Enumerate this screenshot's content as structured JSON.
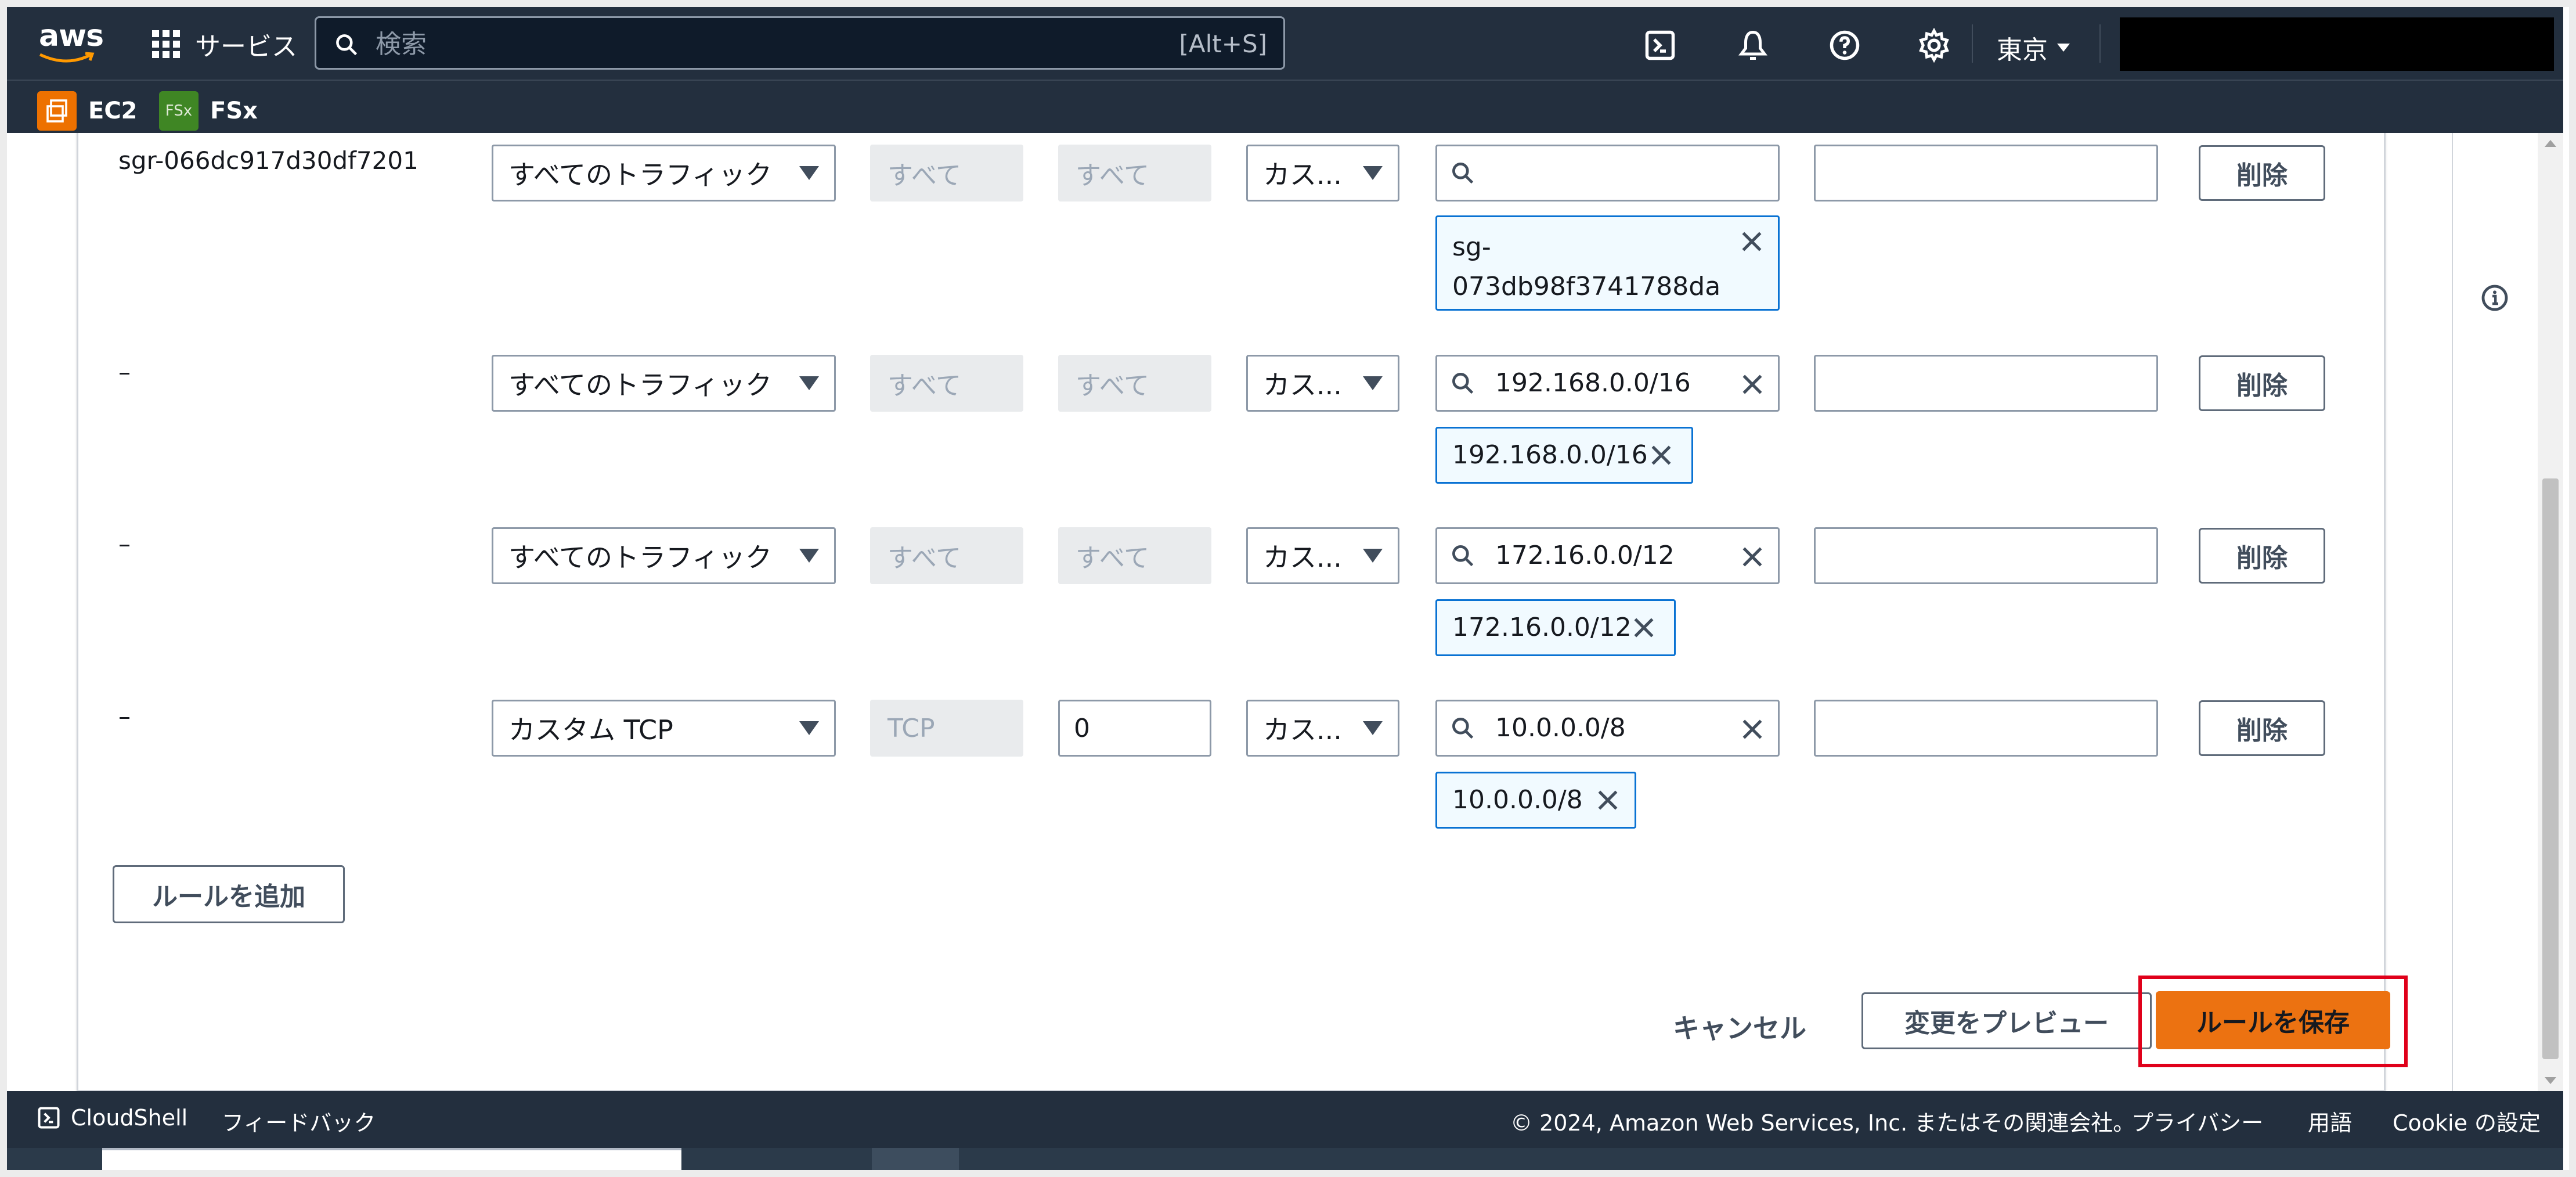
{
  "topnav": {
    "services_label": "サービス",
    "search_placeholder": "検索",
    "search_shortcut": "[Alt+S]",
    "region_label": "東京",
    "favorites": [
      {
        "label": "EC2",
        "badge_color": "#ed7100"
      },
      {
        "label": "FSx",
        "badge_text": "FSx",
        "badge_color": "#3f8624"
      }
    ]
  },
  "rules": [
    {
      "id": "sgr-066dc917d30df7201",
      "type": "すべてのトラフィック",
      "protocol": "すべて",
      "port": "すべて",
      "source_type": "カス...",
      "search_value": "",
      "token": "sg-\n073db98f3741788da",
      "delete_label": "削除"
    },
    {
      "id": "–",
      "type": "すべてのトラフィック",
      "protocol": "すべて",
      "port": "すべて",
      "source_type": "カス...",
      "search_value": "192.168.0.0/16",
      "token": "192.168.0.0/16",
      "delete_label": "削除"
    },
    {
      "id": "–",
      "type": "すべてのトラフィック",
      "protocol": "すべて",
      "port": "すべて",
      "source_type": "カス...",
      "search_value": "172.16.0.0/12",
      "token": "172.16.0.0/12",
      "delete_label": "削除"
    },
    {
      "id": "–",
      "type": "カスタム TCP",
      "protocol": "TCP",
      "port": "0",
      "source_type": "カス...",
      "search_value": "10.0.0.0/8",
      "token": "10.0.0.0/8",
      "delete_label": "削除"
    }
  ],
  "actions": {
    "add_rule": "ルールを追加",
    "cancel": "キャンセル",
    "preview": "変更をプレビュー",
    "save": "ルールを保存"
  },
  "footer": {
    "cloudshell": "CloudShell",
    "feedback": "フィードバック",
    "copyright": "© 2024, Amazon Web Services, Inc. またはその関連会社。",
    "privacy": "プライバシー",
    "terms": "用語",
    "cookie": "Cookie の設定"
  },
  "colors": {
    "primary_button": "#ec7211",
    "highlight": "#e0001a",
    "nav_bg": "#232f3e"
  }
}
